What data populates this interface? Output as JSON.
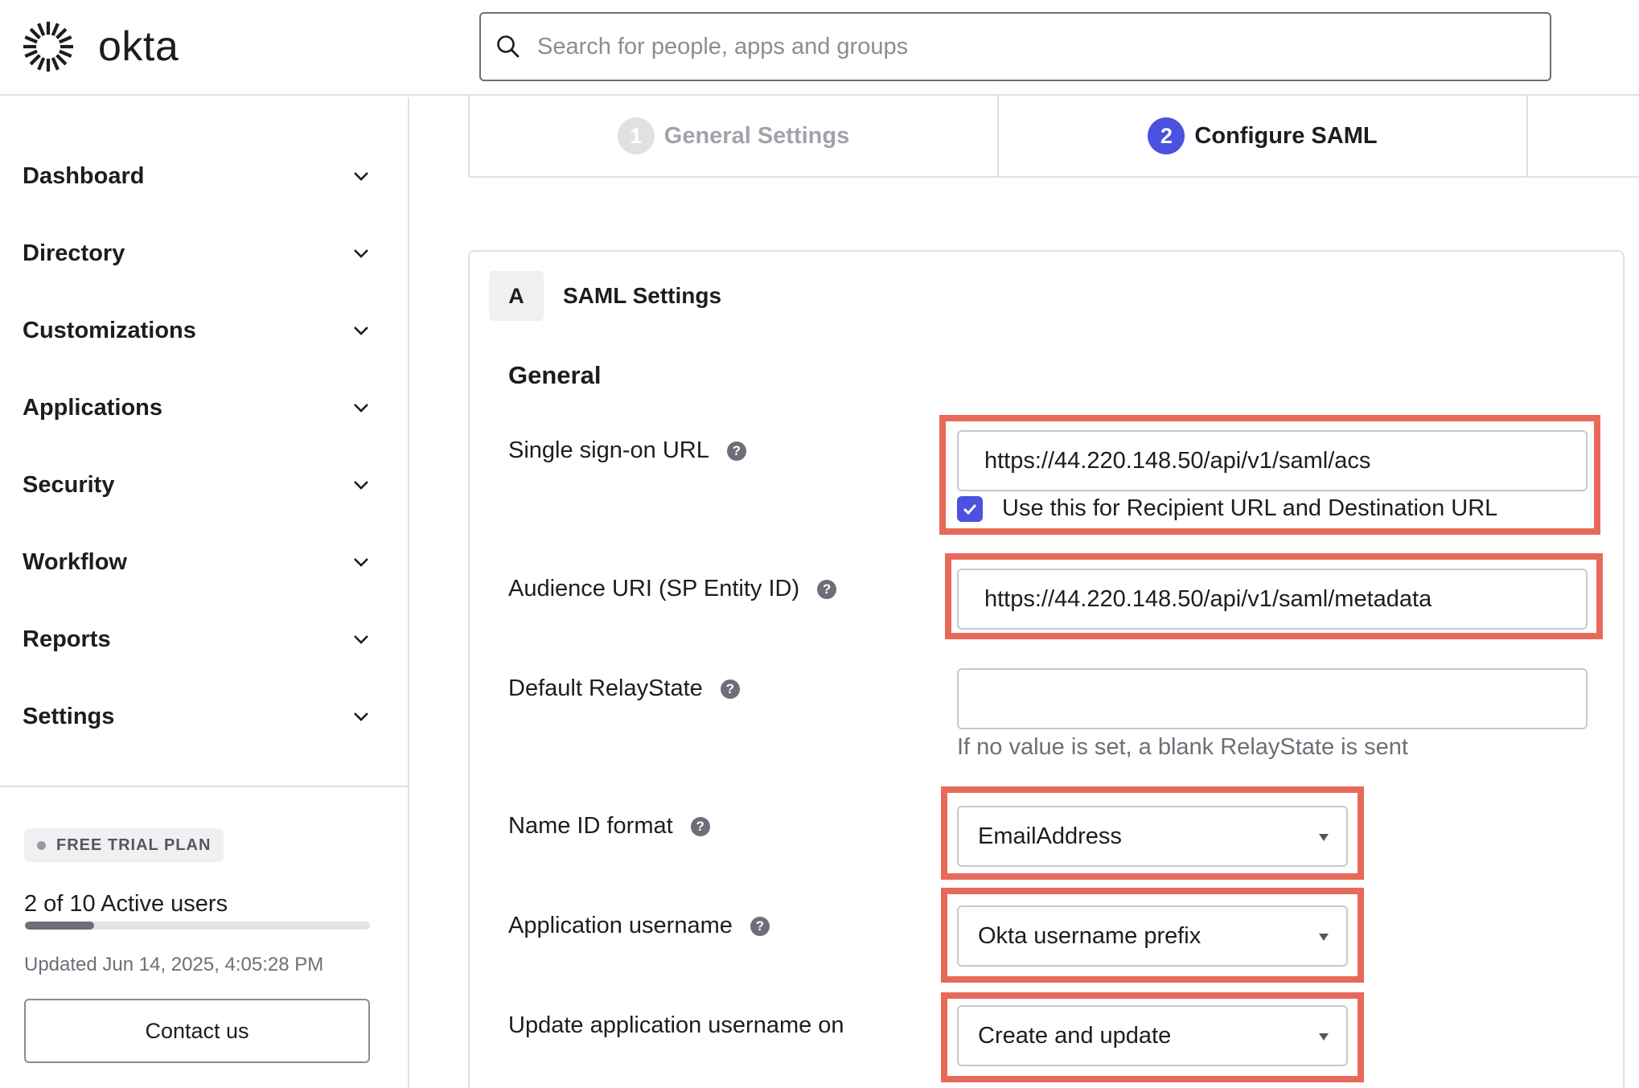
{
  "header": {
    "logo_text": "okta",
    "search_placeholder": "Search for people, apps and groups"
  },
  "sidebar": {
    "items": [
      {
        "label": "Dashboard"
      },
      {
        "label": "Directory"
      },
      {
        "label": "Customizations"
      },
      {
        "label": "Applications"
      },
      {
        "label": "Security"
      },
      {
        "label": "Workflow"
      },
      {
        "label": "Reports"
      },
      {
        "label": "Settings"
      }
    ],
    "plan_badge": "FREE TRIAL PLAN",
    "active_users_text": "2 of 10 Active users",
    "active_users_fraction": 0.2,
    "updated_text": "Updated Jun 14, 2025, 4:05:28 PM",
    "contact_button": "Contact us"
  },
  "steps": [
    {
      "number": "1",
      "label": "General Settings",
      "state": "completed"
    },
    {
      "number": "2",
      "label": "Configure SAML",
      "state": "active"
    }
  ],
  "card": {
    "badge": "A",
    "title": "SAML Settings",
    "section_title": "General",
    "fields": {
      "sso_url": {
        "label": "Single sign-on URL",
        "value": "https://44.220.148.50/api/v1/saml/acs",
        "checkbox_label": "Use this for Recipient URL and Destination URL",
        "checkbox_checked": true
      },
      "audience_uri": {
        "label": "Audience URI (SP Entity ID)",
        "value": "https://44.220.148.50/api/v1/saml/metadata"
      },
      "relay_state": {
        "label": "Default RelayState",
        "value": "",
        "hint": "If no value is set, a blank RelayState is sent"
      },
      "name_id_format": {
        "label": "Name ID format",
        "value": "EmailAddress"
      },
      "app_username": {
        "label": "Application username",
        "value": "Okta username prefix"
      },
      "update_username_on": {
        "label": "Update application username on",
        "value": "Create and update"
      }
    }
  },
  "colors": {
    "accent": "#4b52e0",
    "highlight": "#e8695a",
    "border": "#e1e1e4"
  }
}
